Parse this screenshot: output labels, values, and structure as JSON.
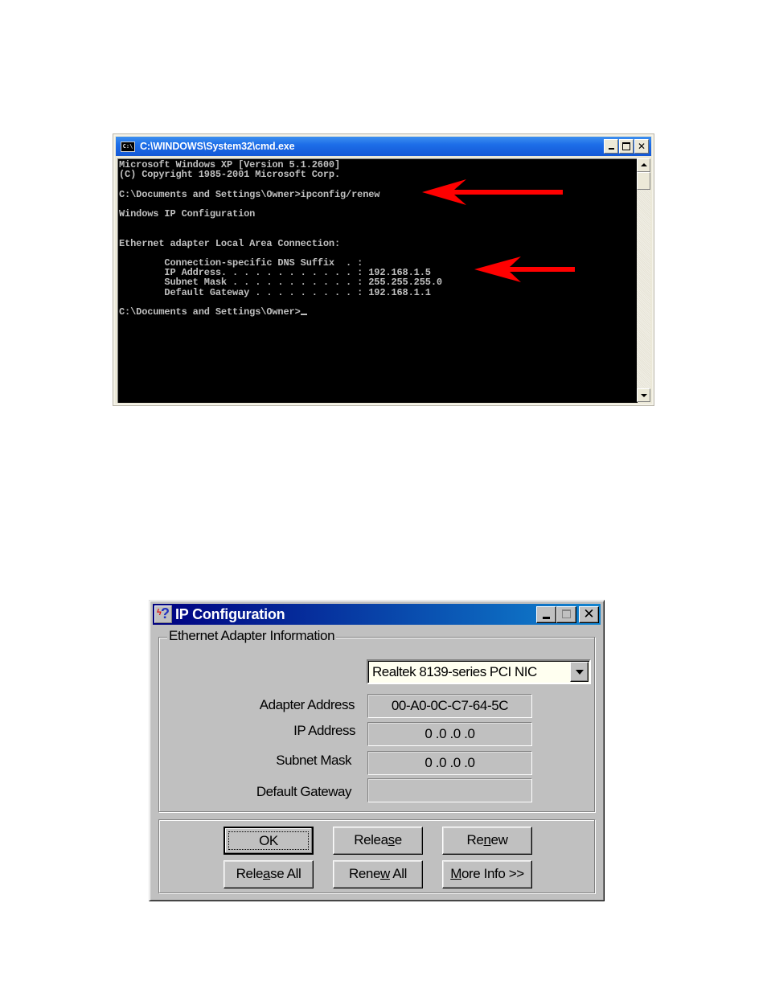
{
  "cmd_window": {
    "title": "C:\\WINDOWS\\System32\\cmd.exe",
    "icon": "console-icon",
    "icon_text": "C:\\",
    "controls": [
      "minimize",
      "maximize",
      "close"
    ],
    "console_lines": [
      "Microsoft Windows XP [Version 5.1.2600]",
      "(C) Copyright 1985-2001 Microsoft Corp.",
      "",
      "C:\\Documents and Settings\\Owner>ipconfig/renew",
      "",
      "Windows IP Configuration",
      "",
      "",
      "Ethernet adapter Local Area Connection:",
      "",
      "        Connection-specific DNS Suffix  . :",
      "        IP Address. . . . . . . . . . . . : 192.168.1.5",
      "        Subnet Mask . . . . . . . . . . . : 255.255.255.0",
      "        Default Gateway . . . . . . . . . : 192.168.1.1",
      "",
      "C:\\Documents and Settings\\Owner>"
    ],
    "text_color": "#c0c0c0",
    "background_color": "#000000"
  },
  "annotations": {
    "arrow_color": "#ff0000",
    "arrows": [
      {
        "points_to": "ipconfig/renew command"
      },
      {
        "points_to": "IP Address 192.168.1.5"
      }
    ]
  },
  "ip_config_dialog": {
    "title": "IP Configuration",
    "group_label": "Ethernet  Adapter Information",
    "adapter_select": {
      "selected": "Realtek 8139-series PCI NIC"
    },
    "fields": [
      {
        "label": "Adapter Address",
        "value": "00-A0-0C-C7-64-5C"
      },
      {
        "label": "IP Address",
        "value": "0 .0 .0 .0"
      },
      {
        "label": "Subnet Mask",
        "value": "0 .0 .0 .0"
      },
      {
        "label": "Default Gateway",
        "value": ""
      }
    ],
    "buttons": {
      "ok": "OK",
      "release": {
        "pre": "Relea",
        "u": "s",
        "post": "e"
      },
      "renew": {
        "pre": "Re",
        "u": "n",
        "post": "ew"
      },
      "release_all": {
        "pre": "Rele",
        "u": "a",
        "post": "se All"
      },
      "renew_all": {
        "pre": "Rene",
        "u": "w",
        "post": " All"
      },
      "more_info": {
        "pre": "",
        "u": "M",
        "post": "ore Info >>"
      }
    },
    "title_gradient": [
      "#000080",
      "#1084d0"
    ]
  }
}
